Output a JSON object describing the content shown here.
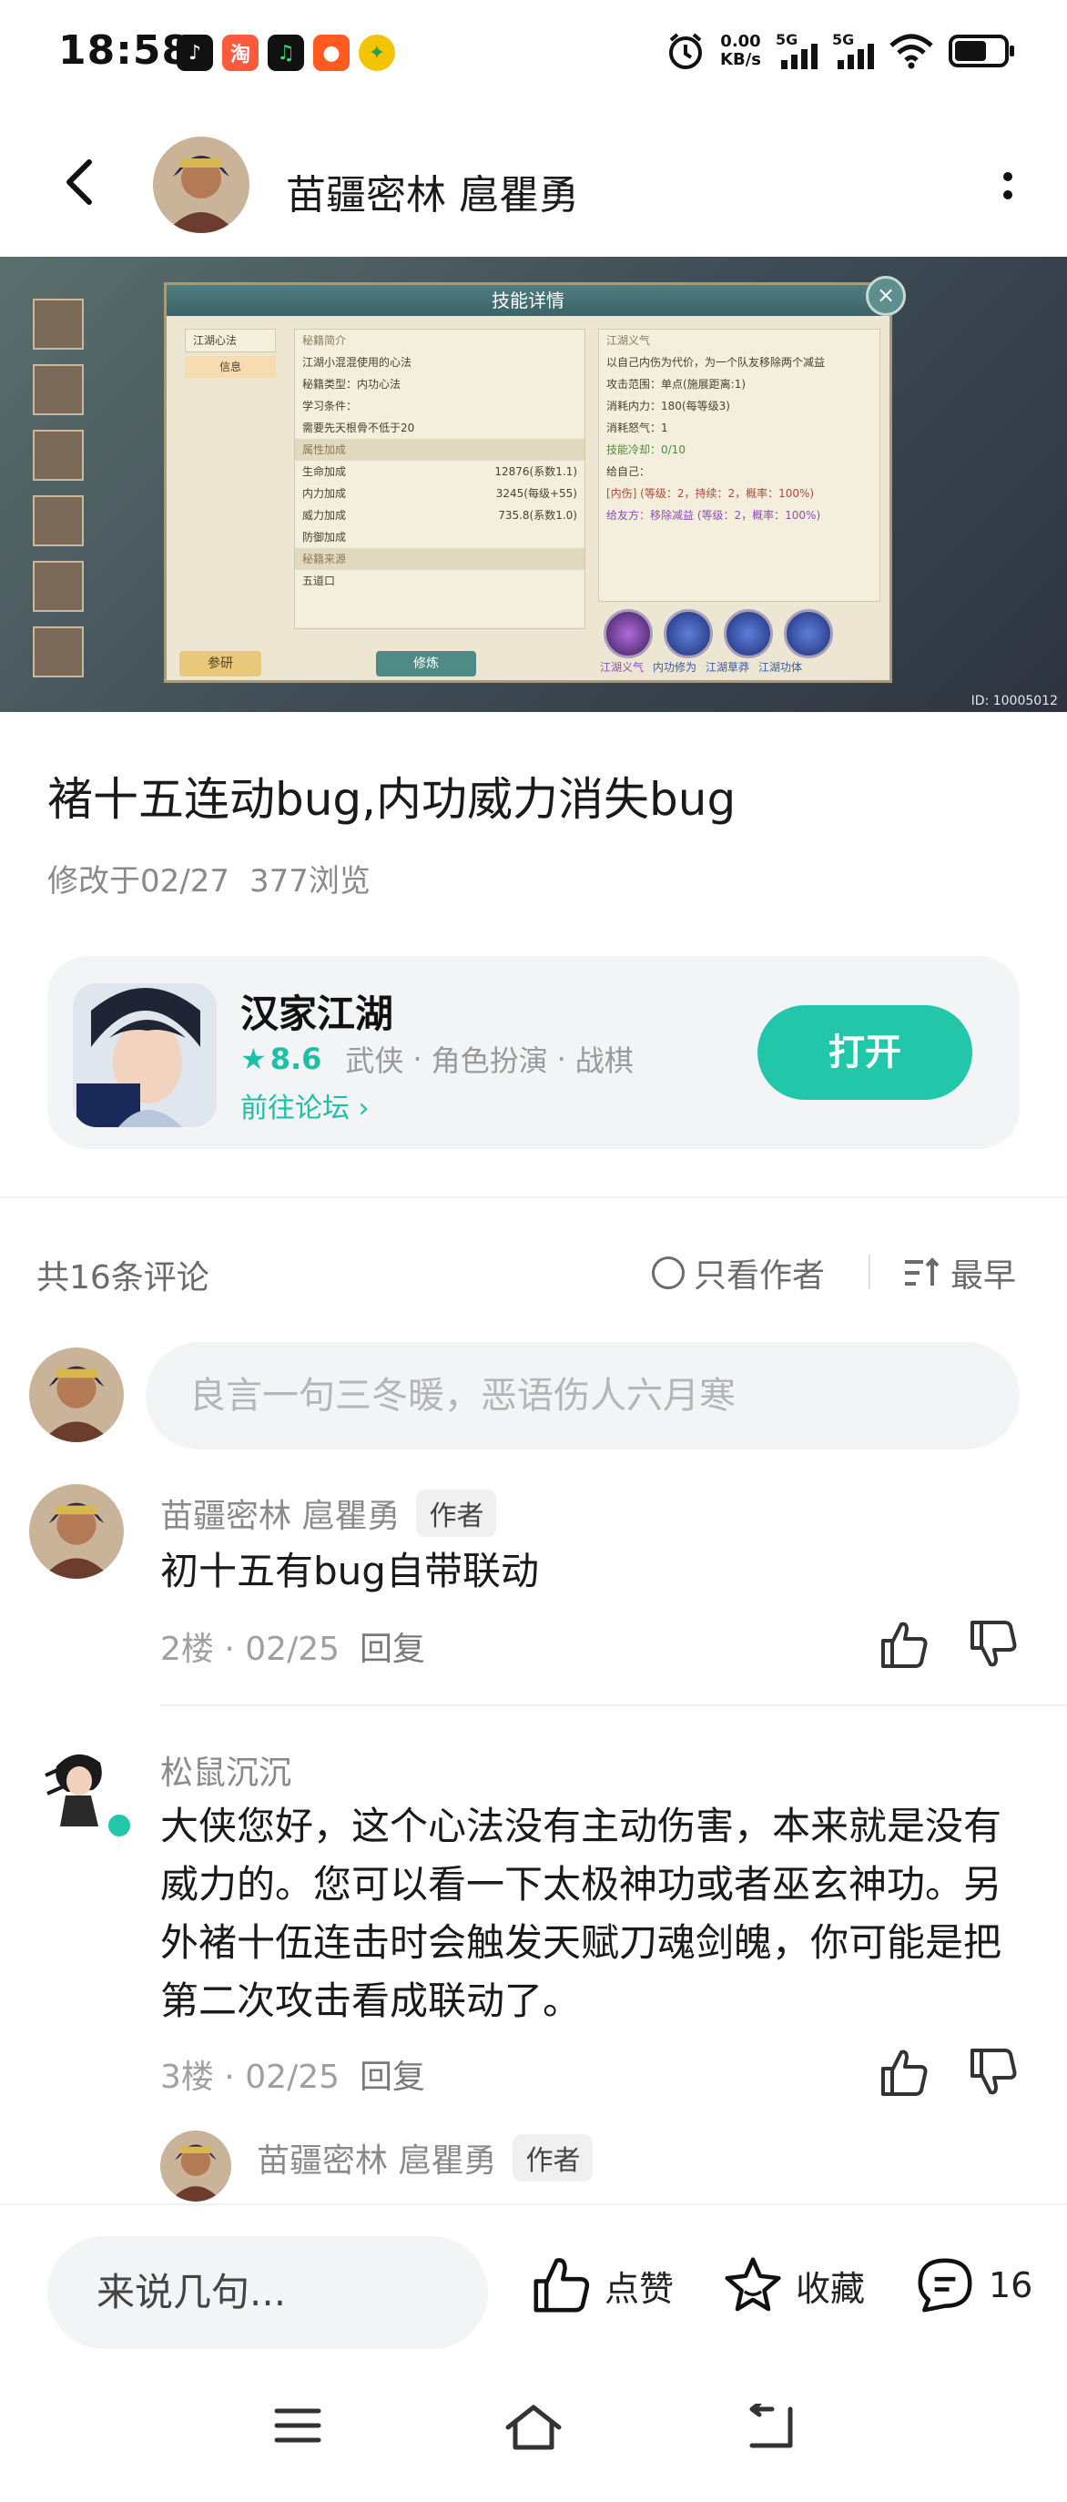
{
  "status_bar": {
    "time": "18:58",
    "net_speed_top": "0.00",
    "net_speed_bottom": "KB/s",
    "signal1_label": "5G",
    "signal2_label": "5G",
    "app_icons": [
      "tiktok-icon",
      "taobao-icon",
      "music-icon",
      "game-icon",
      "coin-icon"
    ],
    "app_icon_label_taobao": "淘"
  },
  "header": {
    "title": "苗疆密林 扈瞿勇"
  },
  "banner": {
    "panel_title": "技能详情",
    "left_tabs": [
      "江湖心法",
      "信息"
    ],
    "col_b": [
      "秘籍简介",
      "江湖小混混使用的心法",
      "秘籍类型：内功心法",
      "学习条件：",
      "需要先天根骨不低于20",
      "属性加成",
      "生命加成",
      "内力加成",
      "威力加成",
      "防御加成",
      "秘籍来源",
      "五道口"
    ],
    "col_b_values": [
      "12876(系数1.1)",
      "3245(每级+55)",
      "735.8(系数1.0)"
    ],
    "col_c": [
      "江湖义气",
      "以自己内伤为代价，为一个队友移除两个减益",
      "攻击范围：单点(施展距离:1)",
      "消耗内力：180(每等级3)",
      "消耗怒气：1",
      "技能冷却：0/10",
      "给自己：",
      "[内伤] (等级：2，持续：2，概率：100%)",
      "给友方：移除减益 (等级：2，概率：100%)"
    ],
    "skill_labels": [
      "江湖义气",
      "内功修为",
      "江湖草莽",
      "江湖功体"
    ],
    "btn_left": "参研",
    "btn_mid": "修炼",
    "id_text": "ID: 10005012"
  },
  "post": {
    "title": "褚十五连动bug,内功威力消失bug",
    "modified": "修改于02/27",
    "views": "377浏览"
  },
  "app_card": {
    "name": "汉家江湖",
    "rating": "8.6",
    "tags": [
      "武侠",
      "角色扮演",
      "战棋"
    ],
    "tag_sep": "·",
    "forum_link": "前往论坛",
    "open_button": "打开",
    "accent_color": "#22c7aa"
  },
  "comments_header": {
    "count_label": "共16条评论",
    "only_author": "只看作者",
    "sort": "最早"
  },
  "comment_input": {
    "placeholder": "良言一句三冬暖，恶语伤人六月寒"
  },
  "comments": [
    {
      "user": "苗疆密林 扈瞿勇",
      "tag": "作者",
      "text": "初十五有bug自带联动",
      "floor": "2楼",
      "date": "02/25",
      "reply": "回复"
    },
    {
      "user": "松鼠沉沉",
      "text": "大侠您好，这个心法没有主动伤害，本来就是没有威力的。您可以看一下太极神功或者巫玄神功。另外褚十伍连击时会触发天赋刀魂剑魄，你可能是把第二次攻击看成联动了。",
      "floor": "3楼",
      "date": "02/25",
      "reply": "回复"
    }
  ],
  "sub_reply": {
    "user": "苗疆密林 扈瞿勇",
    "tag": "作者"
  },
  "meta_sep": "·",
  "bottom_bar": {
    "input_placeholder": "来说几句...",
    "like": "点赞",
    "favorite": "收藏",
    "comment_count": "16"
  }
}
